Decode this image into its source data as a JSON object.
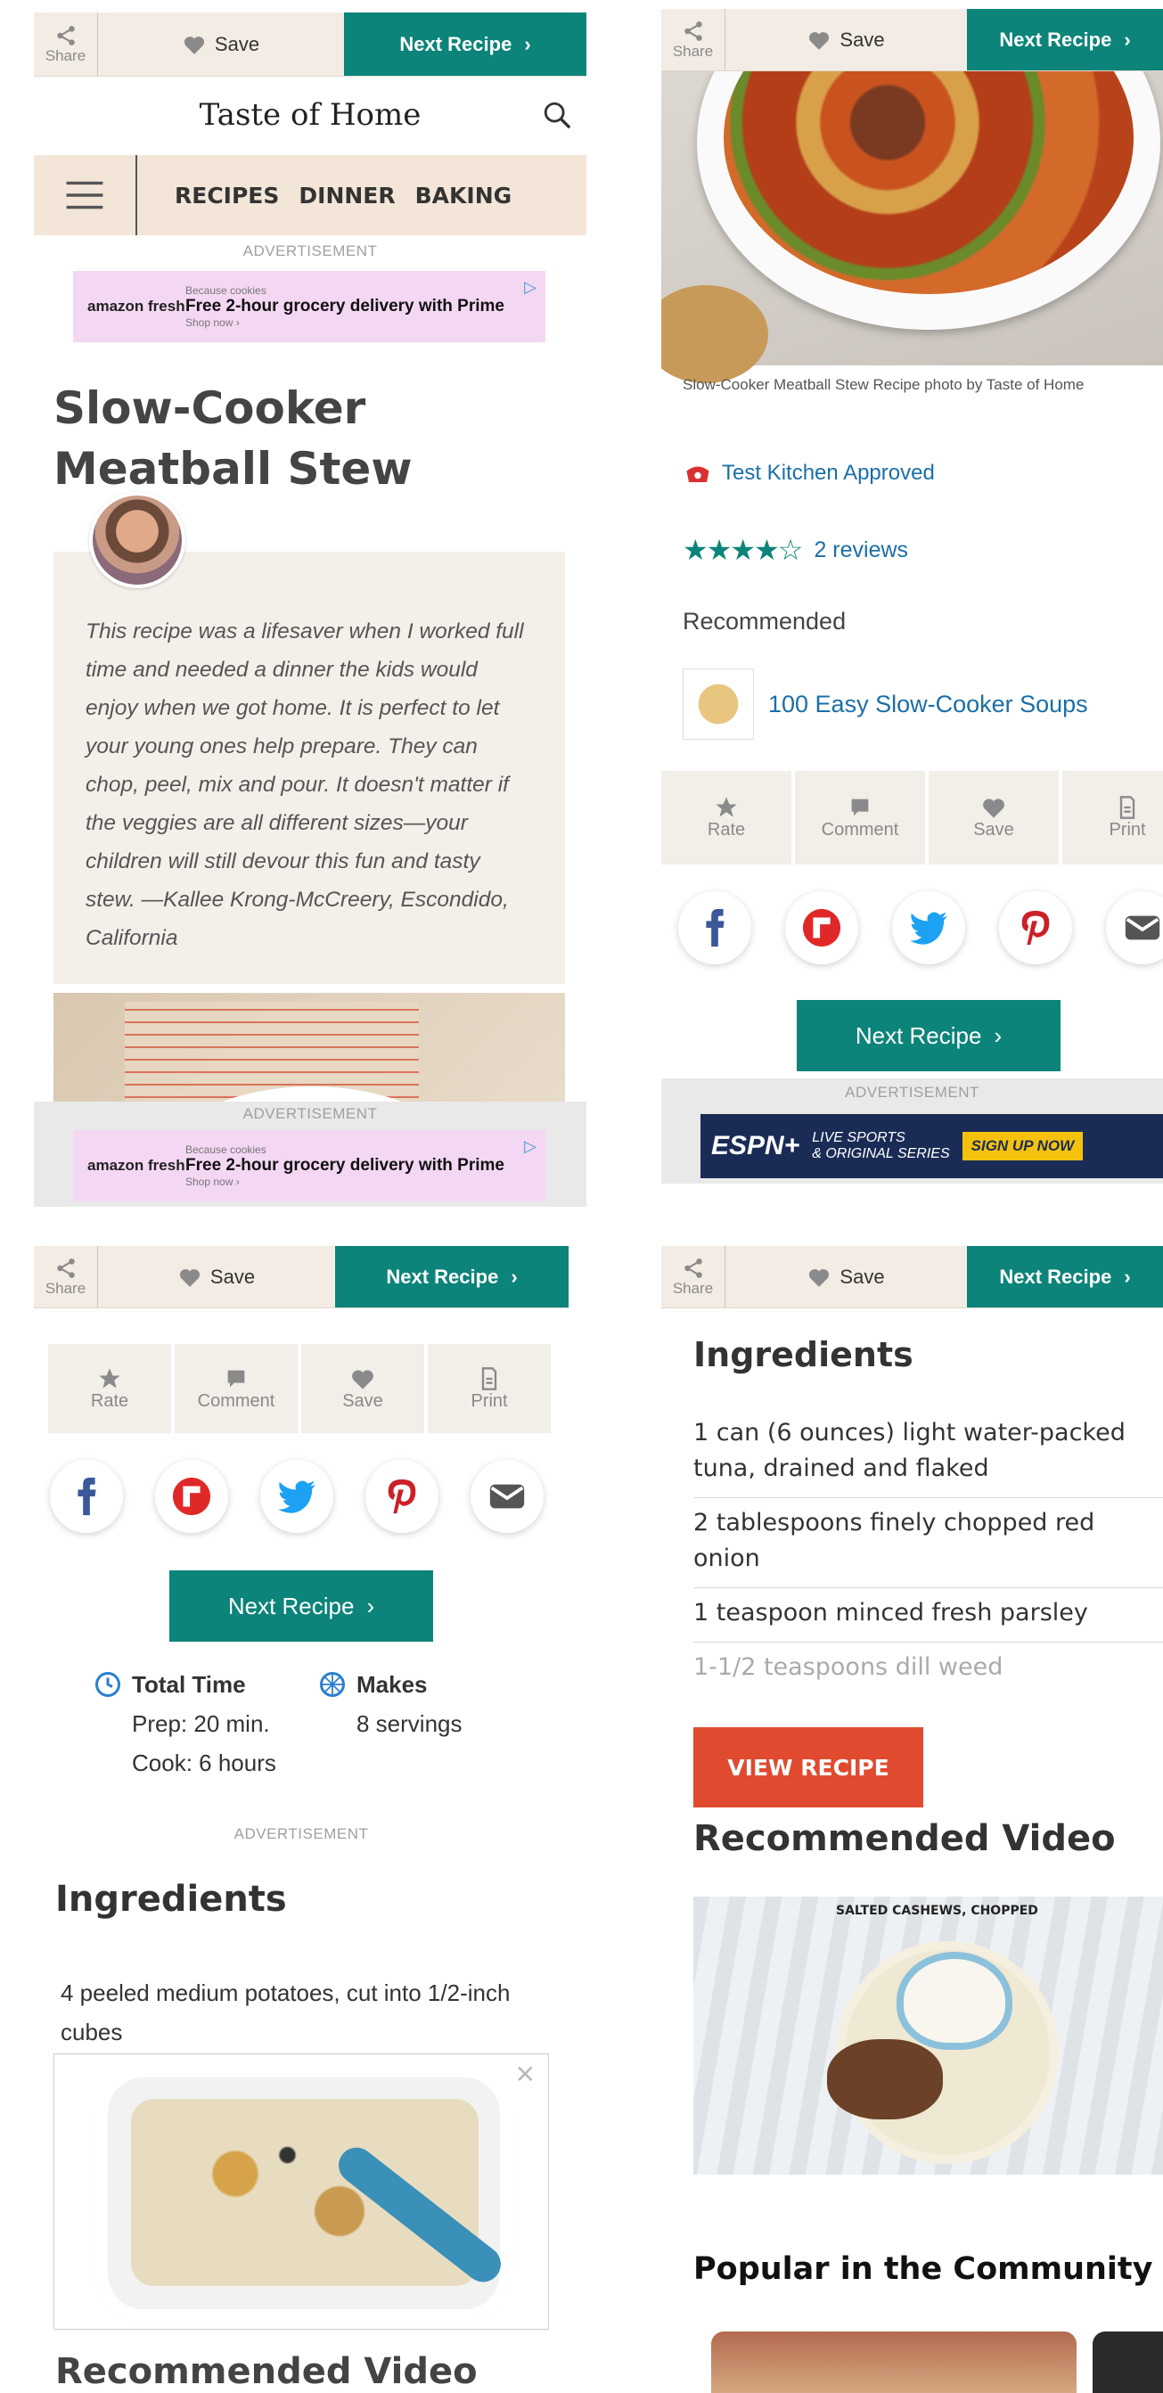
{
  "topbar": {
    "share_label": "Share",
    "save_label": "Save",
    "next_label": "Next Recipe"
  },
  "site": {
    "logo": "Taste of Home",
    "nav": [
      "RECIPES",
      "DINNER",
      "BAKING"
    ]
  },
  "ad": {
    "label": "ADVERTISEMENT",
    "brand": "amazon fresh",
    "small": "Because cookies",
    "headline": "Free 2-hour grocery delivery with Prime",
    "shop": "Shop now ›"
  },
  "recipe": {
    "title": "Slow-Cooker Meatball Stew",
    "description": "This recipe was a lifesaver when I worked full time and needed a dinner the kids would enjoy when we got home. It is perfect to let your young ones help prepare. They can chop, peel, mix and pour. It doesn't matter if the veggies are all different sizes—your children will still devour this fun and tasty stew. —Kallee Krong-McCreery, Escondido, California",
    "photo_caption": "Slow-Cooker Meatball Stew Recipe photo by Taste of Home",
    "approved": "Test Kitchen Approved",
    "rating": 4,
    "reviews": "2 reviews",
    "recommended_label": "Recommended",
    "recommended_link": "100 Easy Slow-Cooker Soups"
  },
  "toolbar": {
    "rate": "Rate",
    "comment": "Comment",
    "save": "Save",
    "print": "Print"
  },
  "next_button": "Next Recipe",
  "espn": {
    "logo": "ESPN+",
    "tagline_1": "LIVE SPORTS",
    "tagline_2": "& ORIGINAL SERIES",
    "cta": "SIGN UP NOW"
  },
  "times": {
    "total_label": "Total Time",
    "prep": "Prep: 20 min.",
    "cook": "Cook: 6 hours",
    "makes_label": "Makes",
    "servings": "8 servings"
  },
  "ingredients": {
    "heading": "Ingredients",
    "first": "4 peeled medium potatoes, cut into 1/2-inch cubes"
  },
  "recommended_video": "Recommended Video",
  "panel4": {
    "ingredients_heading": "Ingredients",
    "items": [
      "1 can (6 ounces) light water-packed tuna, drained and flaked",
      "2 tablespoons finely chopped red onion",
      "1 teaspoon minced fresh parsley",
      "1-1/2 teaspoons dill weed"
    ],
    "view_recipe": "VIEW RECIPE",
    "video_heading": "Recommended Video",
    "video_caption": "SALTED CASHEWS, CHOPPED",
    "community_heading": "Popular in the Community"
  },
  "colors": {
    "teal": "#0c8479",
    "beige": "#f3ece4",
    "orange": "#e04a2f",
    "link": "#1a6fa8"
  }
}
